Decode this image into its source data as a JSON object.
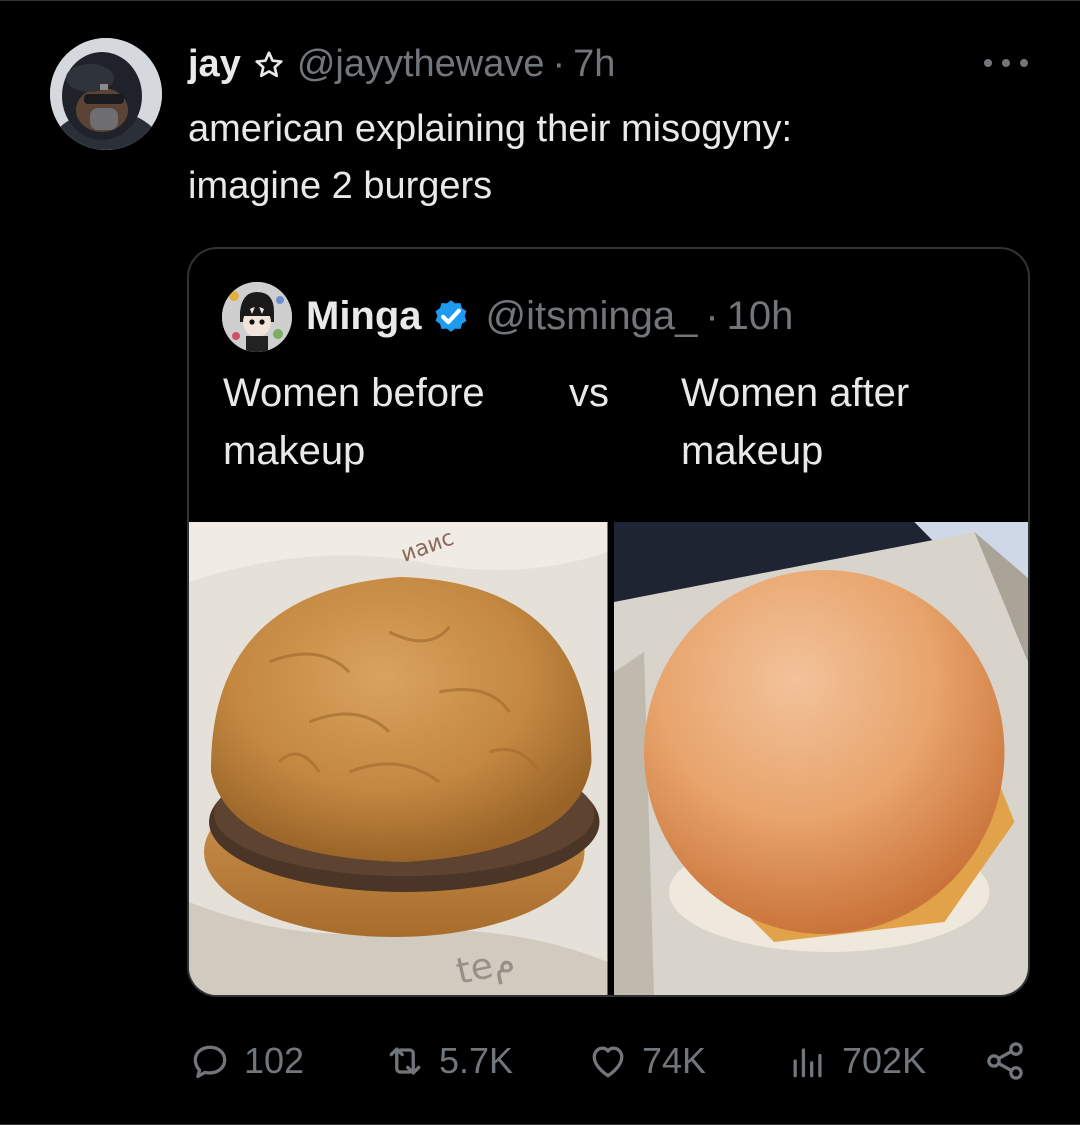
{
  "tweet": {
    "author": {
      "name": "jay",
      "handle": "@jayythewave",
      "time": "7h",
      "dot": "·"
    },
    "text_lines": [
      "american explaining their misogyny:",
      "imagine 2 burgers"
    ]
  },
  "quote": {
    "author": {
      "name": "Minga",
      "handle": "@itsminga_",
      "time": "10h",
      "dot": "·",
      "verified": true
    },
    "left_text": [
      "Women before",
      "makeup"
    ],
    "middle_text": "vs",
    "right_text": [
      "Women after",
      "makeup"
    ],
    "images": [
      {
        "icon": "burger-regular-image",
        "wrapper_text_1": "иаис",
        "wrapper_text_2": "teم"
      },
      {
        "icon": "burger-smooth-bun-image"
      }
    ]
  },
  "actions": {
    "replies": "102",
    "reposts": "5.7K",
    "likes": "74K",
    "views": "702K"
  },
  "colors": {
    "background": "#000000",
    "text": "#e7e9ea",
    "muted": "#71767b",
    "border": "#2f3336",
    "verified": "#1d9bf0"
  }
}
